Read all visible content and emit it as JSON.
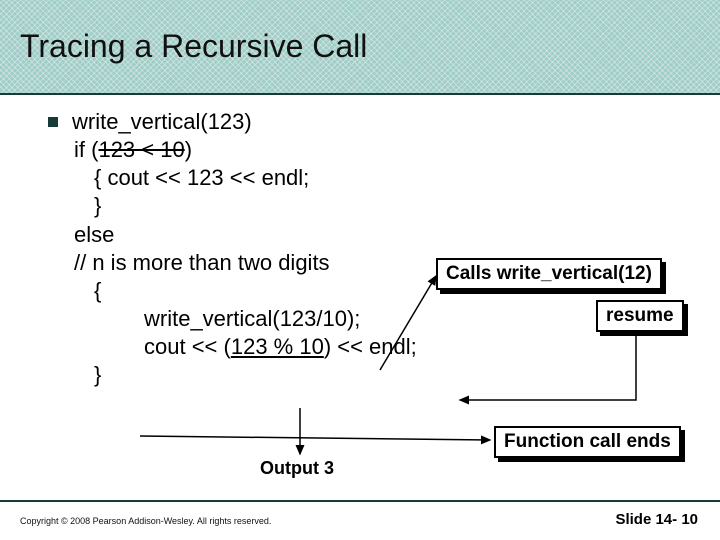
{
  "title": "Tracing a Recursive Call",
  "code": {
    "l1": "write_vertical(123)",
    "l2a": "if (",
    "l2strike": "123 < 10",
    "l2b": ")",
    "l3": "{ cout << 123 << endl;",
    "l4": "}",
    "l5": " else",
    "l6": "// n is more than two digits",
    "l7": "{",
    "l8": "write_vertical(123/10);",
    "l9a": "cout << (",
    "l9u": "123 % 10",
    "l9b": ") << endl;",
    "l10": "}"
  },
  "callouts": {
    "calls": "Calls write_vertical(12)",
    "resume": "resume",
    "ends": "Function call ends"
  },
  "output_label": "Output 3",
  "copyright": "Copyright © 2008 Pearson Addison-Wesley. All rights reserved.",
  "slidenum": "Slide 14- 10"
}
